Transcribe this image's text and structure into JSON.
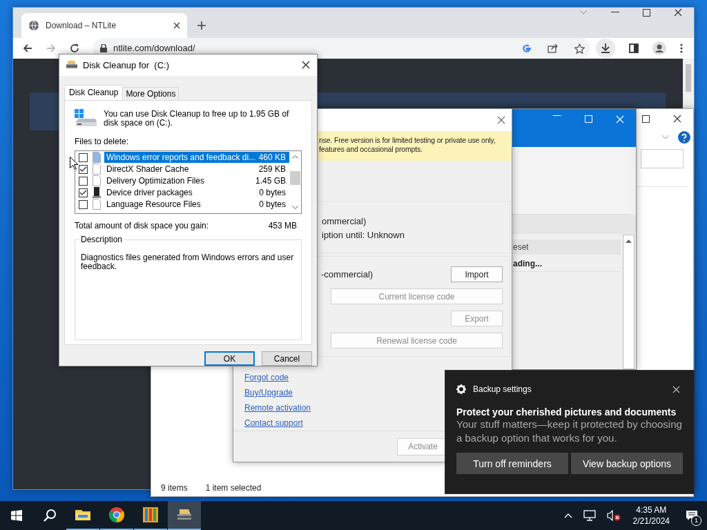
{
  "browser": {
    "tabs": [
      {
        "title": "Download – NTLite",
        "selected": true
      }
    ],
    "address": "ntlite.com/download/"
  },
  "main_window": {
    "status_bar": {
      "item_count": "9 items",
      "selection": "1 item selected"
    }
  },
  "preset_window": {
    "list_header": "eset",
    "rows": [
      "ading..."
    ]
  },
  "license_dialog": {
    "notice": [
      "nse. Free version is for limited testing or private use only,",
      "features and occasional prompts."
    ],
    "license_lines": [
      "ommercial)",
      "iption until: Unknown"
    ],
    "type_label": "-commercial)",
    "buttons": [
      {
        "label": "Import",
        "disabled": false,
        "kind": "small"
      },
      {
        "label": "Current license code",
        "disabled": true,
        "kind": "wide"
      },
      {
        "label": "Export",
        "disabled": true,
        "kind": "small"
      },
      {
        "label": "Renewal license code",
        "disabled": true,
        "kind": "wide"
      }
    ],
    "links": [
      "Forgot code",
      "Buy/Upgrade",
      "Remote activation",
      "Contact support"
    ],
    "footer_button": {
      "label": "Activate",
      "disabled": true
    }
  },
  "disk_cleanup": {
    "title": "Disk Cleanup for  (C:)",
    "tabs": [
      {
        "label": "Disk Cleanup",
        "selected": true
      },
      {
        "label": "More Options",
        "selected": false
      }
    ],
    "intro": "You can use Disk Cleanup to free up to 1.95 GB of disk space on  (C:).",
    "files_label": "Files to delete:",
    "files": [
      {
        "name": "Windows error reports and feedback di...",
        "size": "460 KB",
        "checked": false,
        "selected": true,
        "kind": "page"
      },
      {
        "name": "DirectX Shader Cache",
        "size": "259 KB",
        "checked": true,
        "selected": false,
        "kind": "page"
      },
      {
        "name": "Delivery Optimization Files",
        "size": "1.45 GB",
        "checked": false,
        "selected": false,
        "kind": "page"
      },
      {
        "name": "Device driver packages",
        "size": "0 bytes",
        "checked": true,
        "selected": false,
        "kind": "device"
      },
      {
        "name": "Language Resource Files",
        "size": "0 bytes",
        "checked": false,
        "selected": false,
        "kind": "page"
      }
    ],
    "total_label": "Total amount of disk space you gain:",
    "total": "453 MB",
    "description_title": "Description",
    "description": "Diagnostics files generated from Windows errors and user feedback.",
    "buttons": [
      {
        "label": "OK",
        "default": true
      },
      {
        "label": "Cancel",
        "default": false
      }
    ]
  },
  "toast": {
    "app": "Backup settings",
    "heading": "Protect your cherished pictures and documents",
    "body": "Your stuff matters—keep it protected by choosing a backup option that works for you.",
    "buttons": [
      "Turn off reminders",
      "View backup options"
    ]
  },
  "taskbar": {
    "apps": [
      {
        "kind": "explorer",
        "running": true,
        "active": false
      },
      {
        "kind": "chrome",
        "running": true,
        "active": false
      },
      {
        "kind": "ntlite",
        "running": true,
        "active": false
      },
      {
        "kind": "diskcleanup",
        "running": true,
        "active": true
      }
    ],
    "time": "4:35 AM",
    "date": "2/21/2024",
    "notification_count": "1"
  }
}
